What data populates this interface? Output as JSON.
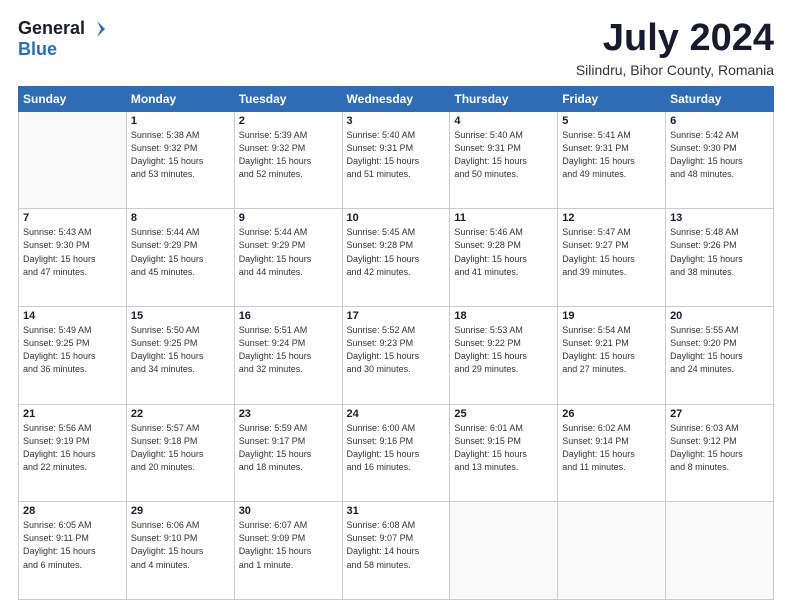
{
  "logo": {
    "general": "General",
    "blue": "Blue"
  },
  "title": "July 2024",
  "subtitle": "Silindru, Bihor County, Romania",
  "weekdays": [
    "Sunday",
    "Monday",
    "Tuesday",
    "Wednesday",
    "Thursday",
    "Friday",
    "Saturday"
  ],
  "weeks": [
    [
      {
        "day": "",
        "info": ""
      },
      {
        "day": "1",
        "info": "Sunrise: 5:38 AM\nSunset: 9:32 PM\nDaylight: 15 hours\nand 53 minutes."
      },
      {
        "day": "2",
        "info": "Sunrise: 5:39 AM\nSunset: 9:32 PM\nDaylight: 15 hours\nand 52 minutes."
      },
      {
        "day": "3",
        "info": "Sunrise: 5:40 AM\nSunset: 9:31 PM\nDaylight: 15 hours\nand 51 minutes."
      },
      {
        "day": "4",
        "info": "Sunrise: 5:40 AM\nSunset: 9:31 PM\nDaylight: 15 hours\nand 50 minutes."
      },
      {
        "day": "5",
        "info": "Sunrise: 5:41 AM\nSunset: 9:31 PM\nDaylight: 15 hours\nand 49 minutes."
      },
      {
        "day": "6",
        "info": "Sunrise: 5:42 AM\nSunset: 9:30 PM\nDaylight: 15 hours\nand 48 minutes."
      }
    ],
    [
      {
        "day": "7",
        "info": "Sunrise: 5:43 AM\nSunset: 9:30 PM\nDaylight: 15 hours\nand 47 minutes."
      },
      {
        "day": "8",
        "info": "Sunrise: 5:44 AM\nSunset: 9:29 PM\nDaylight: 15 hours\nand 45 minutes."
      },
      {
        "day": "9",
        "info": "Sunrise: 5:44 AM\nSunset: 9:29 PM\nDaylight: 15 hours\nand 44 minutes."
      },
      {
        "day": "10",
        "info": "Sunrise: 5:45 AM\nSunset: 9:28 PM\nDaylight: 15 hours\nand 42 minutes."
      },
      {
        "day": "11",
        "info": "Sunrise: 5:46 AM\nSunset: 9:28 PM\nDaylight: 15 hours\nand 41 minutes."
      },
      {
        "day": "12",
        "info": "Sunrise: 5:47 AM\nSunset: 9:27 PM\nDaylight: 15 hours\nand 39 minutes."
      },
      {
        "day": "13",
        "info": "Sunrise: 5:48 AM\nSunset: 9:26 PM\nDaylight: 15 hours\nand 38 minutes."
      }
    ],
    [
      {
        "day": "14",
        "info": "Sunrise: 5:49 AM\nSunset: 9:25 PM\nDaylight: 15 hours\nand 36 minutes."
      },
      {
        "day": "15",
        "info": "Sunrise: 5:50 AM\nSunset: 9:25 PM\nDaylight: 15 hours\nand 34 minutes."
      },
      {
        "day": "16",
        "info": "Sunrise: 5:51 AM\nSunset: 9:24 PM\nDaylight: 15 hours\nand 32 minutes."
      },
      {
        "day": "17",
        "info": "Sunrise: 5:52 AM\nSunset: 9:23 PM\nDaylight: 15 hours\nand 30 minutes."
      },
      {
        "day": "18",
        "info": "Sunrise: 5:53 AM\nSunset: 9:22 PM\nDaylight: 15 hours\nand 29 minutes."
      },
      {
        "day": "19",
        "info": "Sunrise: 5:54 AM\nSunset: 9:21 PM\nDaylight: 15 hours\nand 27 minutes."
      },
      {
        "day": "20",
        "info": "Sunrise: 5:55 AM\nSunset: 9:20 PM\nDaylight: 15 hours\nand 24 minutes."
      }
    ],
    [
      {
        "day": "21",
        "info": "Sunrise: 5:56 AM\nSunset: 9:19 PM\nDaylight: 15 hours\nand 22 minutes."
      },
      {
        "day": "22",
        "info": "Sunrise: 5:57 AM\nSunset: 9:18 PM\nDaylight: 15 hours\nand 20 minutes."
      },
      {
        "day": "23",
        "info": "Sunrise: 5:59 AM\nSunset: 9:17 PM\nDaylight: 15 hours\nand 18 minutes."
      },
      {
        "day": "24",
        "info": "Sunrise: 6:00 AM\nSunset: 9:16 PM\nDaylight: 15 hours\nand 16 minutes."
      },
      {
        "day": "25",
        "info": "Sunrise: 6:01 AM\nSunset: 9:15 PM\nDaylight: 15 hours\nand 13 minutes."
      },
      {
        "day": "26",
        "info": "Sunrise: 6:02 AM\nSunset: 9:14 PM\nDaylight: 15 hours\nand 11 minutes."
      },
      {
        "day": "27",
        "info": "Sunrise: 6:03 AM\nSunset: 9:12 PM\nDaylight: 15 hours\nand 8 minutes."
      }
    ],
    [
      {
        "day": "28",
        "info": "Sunrise: 6:05 AM\nSunset: 9:11 PM\nDaylight: 15 hours\nand 6 minutes."
      },
      {
        "day": "29",
        "info": "Sunrise: 6:06 AM\nSunset: 9:10 PM\nDaylight: 15 hours\nand 4 minutes."
      },
      {
        "day": "30",
        "info": "Sunrise: 6:07 AM\nSunset: 9:09 PM\nDaylight: 15 hours\nand 1 minute."
      },
      {
        "day": "31",
        "info": "Sunrise: 6:08 AM\nSunset: 9:07 PM\nDaylight: 14 hours\nand 58 minutes."
      },
      {
        "day": "",
        "info": ""
      },
      {
        "day": "",
        "info": ""
      },
      {
        "day": "",
        "info": ""
      }
    ]
  ]
}
